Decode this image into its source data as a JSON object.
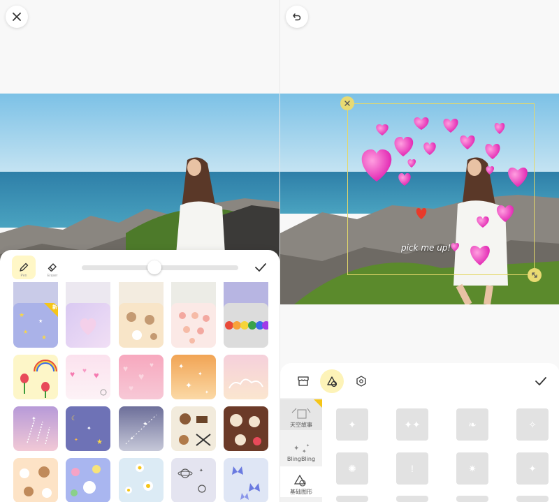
{
  "left_screen": {
    "close_icon": "close-icon",
    "toolbar": {
      "pen_label": "Pen",
      "eraser_label": "Eraser",
      "brush_size": 0.46,
      "confirm_icon": "check-icon"
    },
    "tile_rows": [
      [
        "blue-stars",
        "purple-hearts",
        "peach-bears",
        "pink-donuts",
        "rainbow-dots"
      ],
      [
        "rainbow-tulips",
        "pink-heart-clouds",
        "pink-hearts",
        "orange-sparkle",
        "pink-cloud"
      ],
      [
        "purple-rockets",
        "navy-moons",
        "grey-sparkle",
        "bear-cookies",
        "brown-bears"
      ],
      [
        "tan-bunnies",
        "blue-flowers",
        "daisies",
        "planets",
        "butterflies"
      ]
    ],
    "new_badge": "新"
  },
  "right_screen": {
    "undo_icon": "undo-icon",
    "photo_caption": "pick me up!",
    "sticker_tabs": [
      "store-icon",
      "shape-icon",
      "hexagon-icon"
    ],
    "confirm_icon": "check-icon",
    "categories": [
      {
        "label": "天空故事"
      },
      {
        "label": "BlingBling"
      },
      {
        "label": "基础图形"
      }
    ],
    "colors": {
      "accent": "#f5c518",
      "frame": "#e4d86a"
    }
  }
}
